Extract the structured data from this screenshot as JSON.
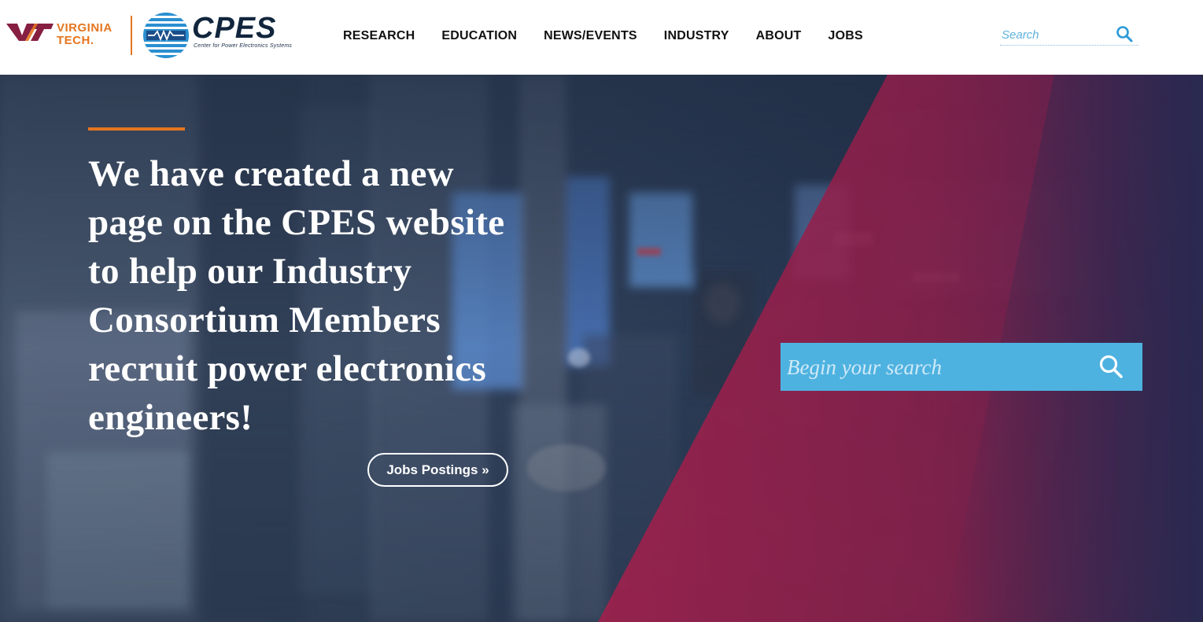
{
  "header": {
    "vt_logo": {
      "line1": "VIRGINIA",
      "line2": "TECH.",
      "mark": "VT"
    },
    "cpes_logo": {
      "name": "CPES",
      "tagline": "Center for Power Electronics Systems"
    },
    "nav": [
      {
        "label": "RESEARCH"
      },
      {
        "label": "EDUCATION"
      },
      {
        "label": "NEWS/EVENTS"
      },
      {
        "label": "INDUSTRY"
      },
      {
        "label": "ABOUT"
      },
      {
        "label": "JOBS"
      }
    ],
    "search": {
      "placeholder": "Search",
      "icon": "search-icon"
    }
  },
  "hero": {
    "headline": "We have created a new page on the CPES website to help our Industry Consortium Members recruit power electronics engineers!",
    "cta_label": "Jobs Postings »",
    "search": {
      "placeholder": "Begin your search",
      "icon": "search-icon"
    }
  },
  "colors": {
    "vt_orange": "#e5751f",
    "vt_maroon": "#861f41",
    "cpes_navy": "#11263d",
    "accent_blue": "#4eb2e0",
    "hero_overlay_crimson": "#9a1f48",
    "hero_overlay_navy": "#252a4d"
  }
}
